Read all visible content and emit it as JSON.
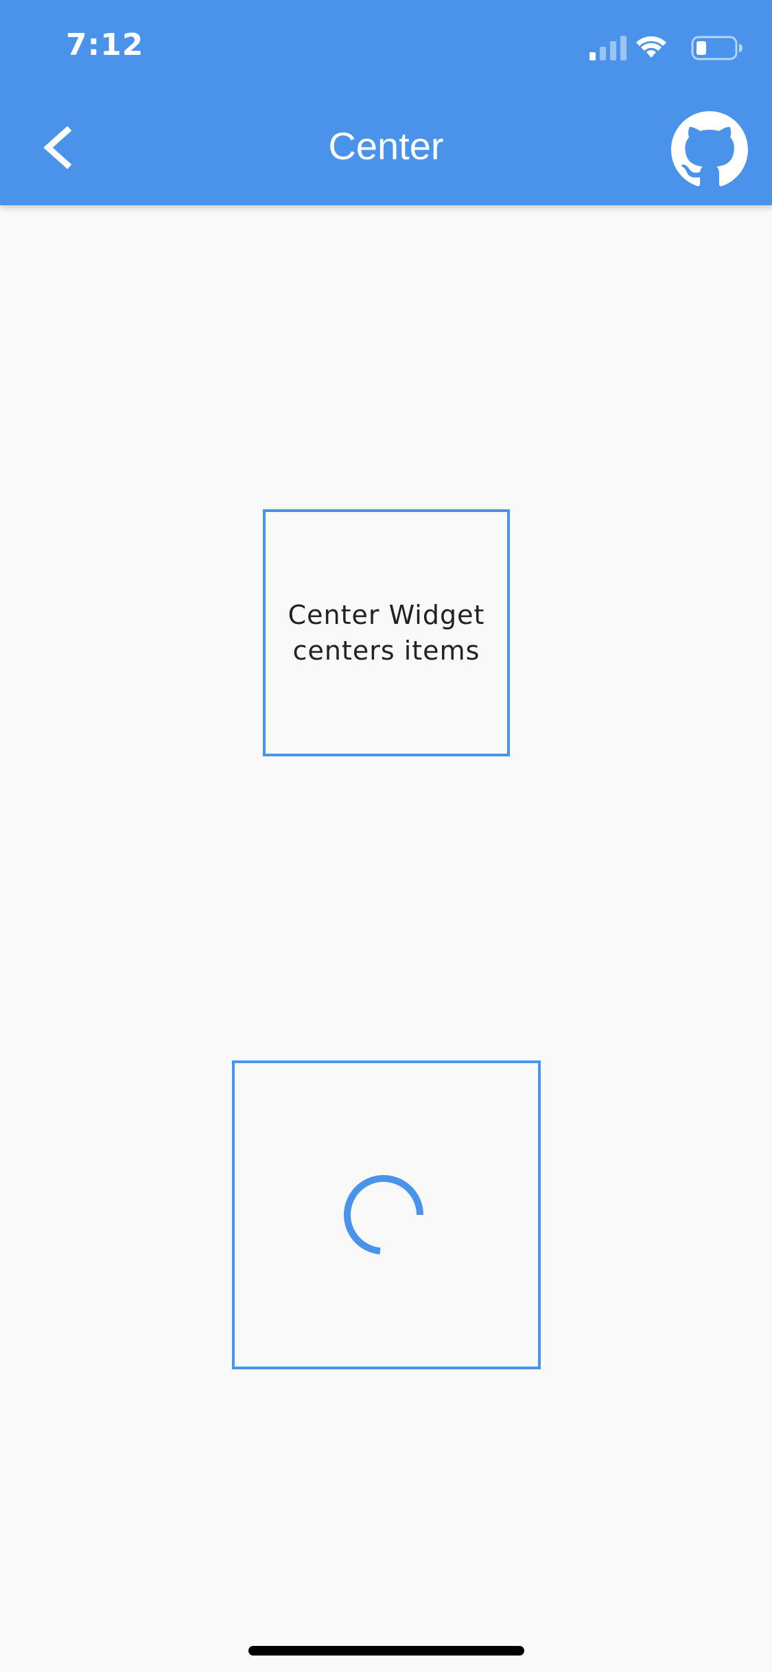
{
  "status_bar": {
    "time": "7:12",
    "signal_icon": "cellular-signal-icon",
    "wifi_icon": "wifi-icon",
    "battery_icon": "battery-low-icon"
  },
  "app_bar": {
    "title": "Center",
    "back_icon": "chevron-left-icon",
    "github_icon": "github-octocat-icon",
    "background_color": "#4a93ea"
  },
  "content": {
    "text_box_label": "Center Widget centers items",
    "spinner_icon": "loading-spinner-icon",
    "accent_color": "#4a93ea"
  }
}
